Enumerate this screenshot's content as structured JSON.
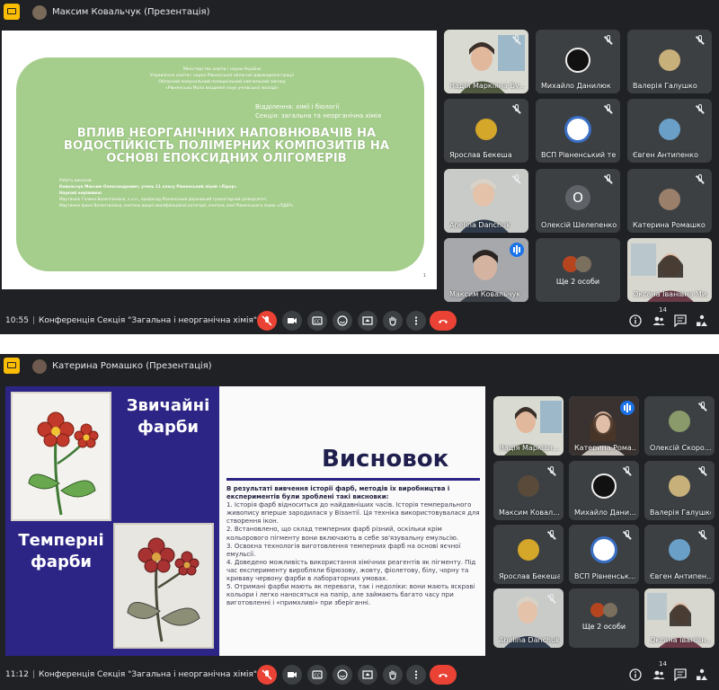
{
  "screen1": {
    "presenter": "Максим Ковальчук (Презентація)",
    "slide": {
      "ministry": [
        "Міністерство освіти і науки  України",
        "Управління освіти і науки Рівненської обласної держадміністрації",
        "Обласний комунальний позашкільний навчальний заклад",
        "«Рівненська Мала академія наук учнівської молоді»"
      ],
      "dept": [
        "Відділення: хімії і біології",
        "Секція: загальна та неорганічна  хімія"
      ],
      "title": [
        "ВПЛИВ НЕОРГАНІЧНИХ НАПОВНЮВАЧІВ  НА",
        "ВОДОСТІЙКІСТЬ ПОЛІМЕРНИХ КОМПОЗИТІВ НА",
        "ОСНОВІ ЕПОКСИДНИХ ОЛІГОМЕРІВ"
      ],
      "info": [
        "Роботу виконав:",
        "Ковальчук Максим Олександрович, учень 11 класу Рівненський ліцей «Лідер»",
        "Наукові керівники:",
        "Мартинюк Галина Валентинівна, к.х.н., професор,Рівненський державний гуманітарний університет,",
        "Мартинюк Ірина Валентинівна, вчитель вищої кваліфікаційної категорії, вчитель хімії Рівненського ліцею «ЛІДЕР»"
      ],
      "page": "1"
    },
    "participants": [
      {
        "name": "Надія Маркіяна Бу..."
      },
      {
        "name": "Михайло Данилюк"
      },
      {
        "name": "Валерія Галушко"
      },
      {
        "name": "Ярослав Бекеша"
      },
      {
        "name": "ВСП Рівненський те..."
      },
      {
        "name": "Євген Антипенко"
      },
      {
        "name": "Anelina Danchuk"
      },
      {
        "name": "Олексій Шелепенко",
        "initial": "О"
      },
      {
        "name": "Катерина Ромашко"
      },
      {
        "name": "Максим Ковальчук"
      },
      {
        "name": "Ще 2 особи"
      },
      {
        "name": "Оксана Іванівна Ми..."
      }
    ],
    "time": "10:55",
    "meeting": "Конференція Секція \"Загальна і неорганічна хімія\"",
    "count": "14"
  },
  "screen2": {
    "presenter": "Катерина Ромашко (Презентація)",
    "slide": {
      "ordinary": [
        "Звичайні",
        "фарби"
      ],
      "tempera": [
        "Темперні",
        "фарби"
      ],
      "heading": "Висновок",
      "intro": "В результаті вивчення історії фарб, методів їх виробництва і експериментів були зроблені такі висновки:",
      "points": [
        "1. Історія фарб відноситься до найдавніших часів. Історія темперального живопису вперше зародилася у Візантії. Ця техніка використовувалася для створення ікон.",
        "2. Встановлено, що склад темперних фарб різний, оскільки крім кольорового пігменту вони включають в себе зв'язувальну емульсію.",
        "3. Освоєна технологія виготовлення темперних фарб на основі яєчної емульсії.",
        "4. Доведено можливість використання хімічних реагентів як пігменту. Під час експерименту виробляли бірюзову, жовту, фіолетову, білу, чорну та криваву червону фарби в лабораторних умовах.",
        "5. Отримані фарби мають як переваги, так і недоліки: вони мають яскраві кольори і легко наносяться на папір, але займають багато часу при виготовленні і «примхливі» при зберіганні."
      ]
    },
    "participants": [
      {
        "name": "Надія Марківн..."
      },
      {
        "name": "Катерина Рома..."
      },
      {
        "name": "Олексій Скоро..."
      },
      {
        "name": "Максим Ковал..."
      },
      {
        "name": "Михайло Дани..."
      },
      {
        "name": "Валерія Галушко"
      },
      {
        "name": "Ярослав Бекеша"
      },
      {
        "name": "ВСП Рівненськ..."
      },
      {
        "name": "Євген Антипен..."
      },
      {
        "name": "Anelina Danchuk"
      },
      {
        "name": "Ще 2 особи"
      },
      {
        "name": "Оксана Іванівн..."
      }
    ],
    "time": "11:12",
    "meeting": "Конференція Секція \"Загальна і неорганічна хімія\"",
    "count": "14"
  }
}
